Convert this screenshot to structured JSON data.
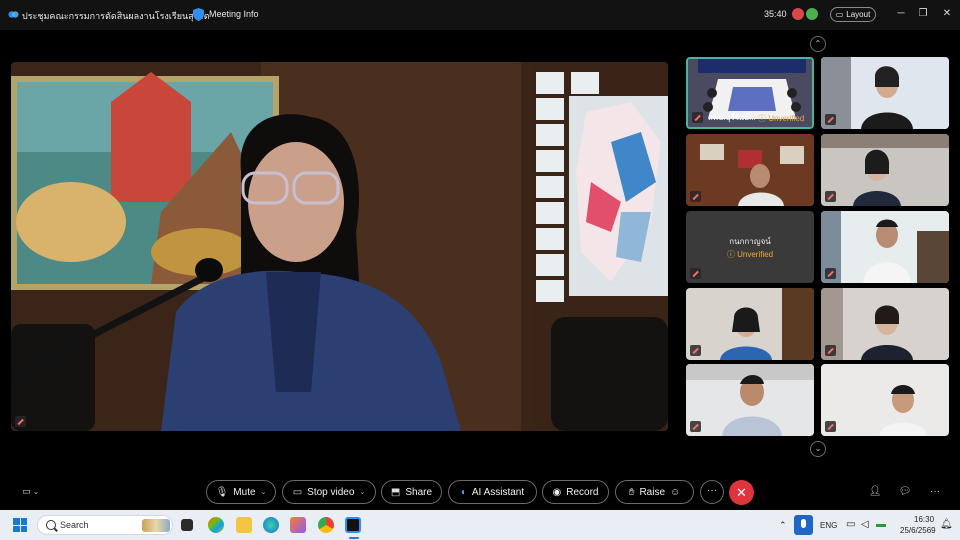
{
  "titlebar": {
    "meeting_title": "ประชุมคณะกรรมการตัดสินผลงานโรงเรียนสุจริต",
    "meeting_info": "Meeting Info",
    "timer": "35:40",
    "layout_label": "Layout"
  },
  "thumbnails": [
    {
      "name": "สพป.บุรีรัมย์...",
      "status": "Unverified",
      "active": true
    },
    {
      "name": "",
      "status": ""
    },
    {
      "name": "",
      "status": ""
    },
    {
      "name": "",
      "status": ""
    },
    {
      "name": "กนกกาญจน์",
      "status": "Unverified",
      "video_off": true
    },
    {
      "name": "",
      "status": ""
    },
    {
      "name": "",
      "status": ""
    },
    {
      "name": "",
      "status": ""
    },
    {
      "name": "",
      "status": ""
    },
    {
      "name": "",
      "status": ""
    }
  ],
  "controls": {
    "mute": "Mute",
    "stop_video": "Stop video",
    "share": "Share",
    "ai_assistant": "AI Assistant",
    "record": "Record",
    "raise": "Raise"
  },
  "taskbar": {
    "search_placeholder": "Search",
    "language": "ENG",
    "time": "16:30",
    "date": "25/6/2569"
  },
  "colors": {
    "active_border": "#48b59a",
    "unverified": "#f0a93a",
    "end_call": "#e0343c"
  }
}
